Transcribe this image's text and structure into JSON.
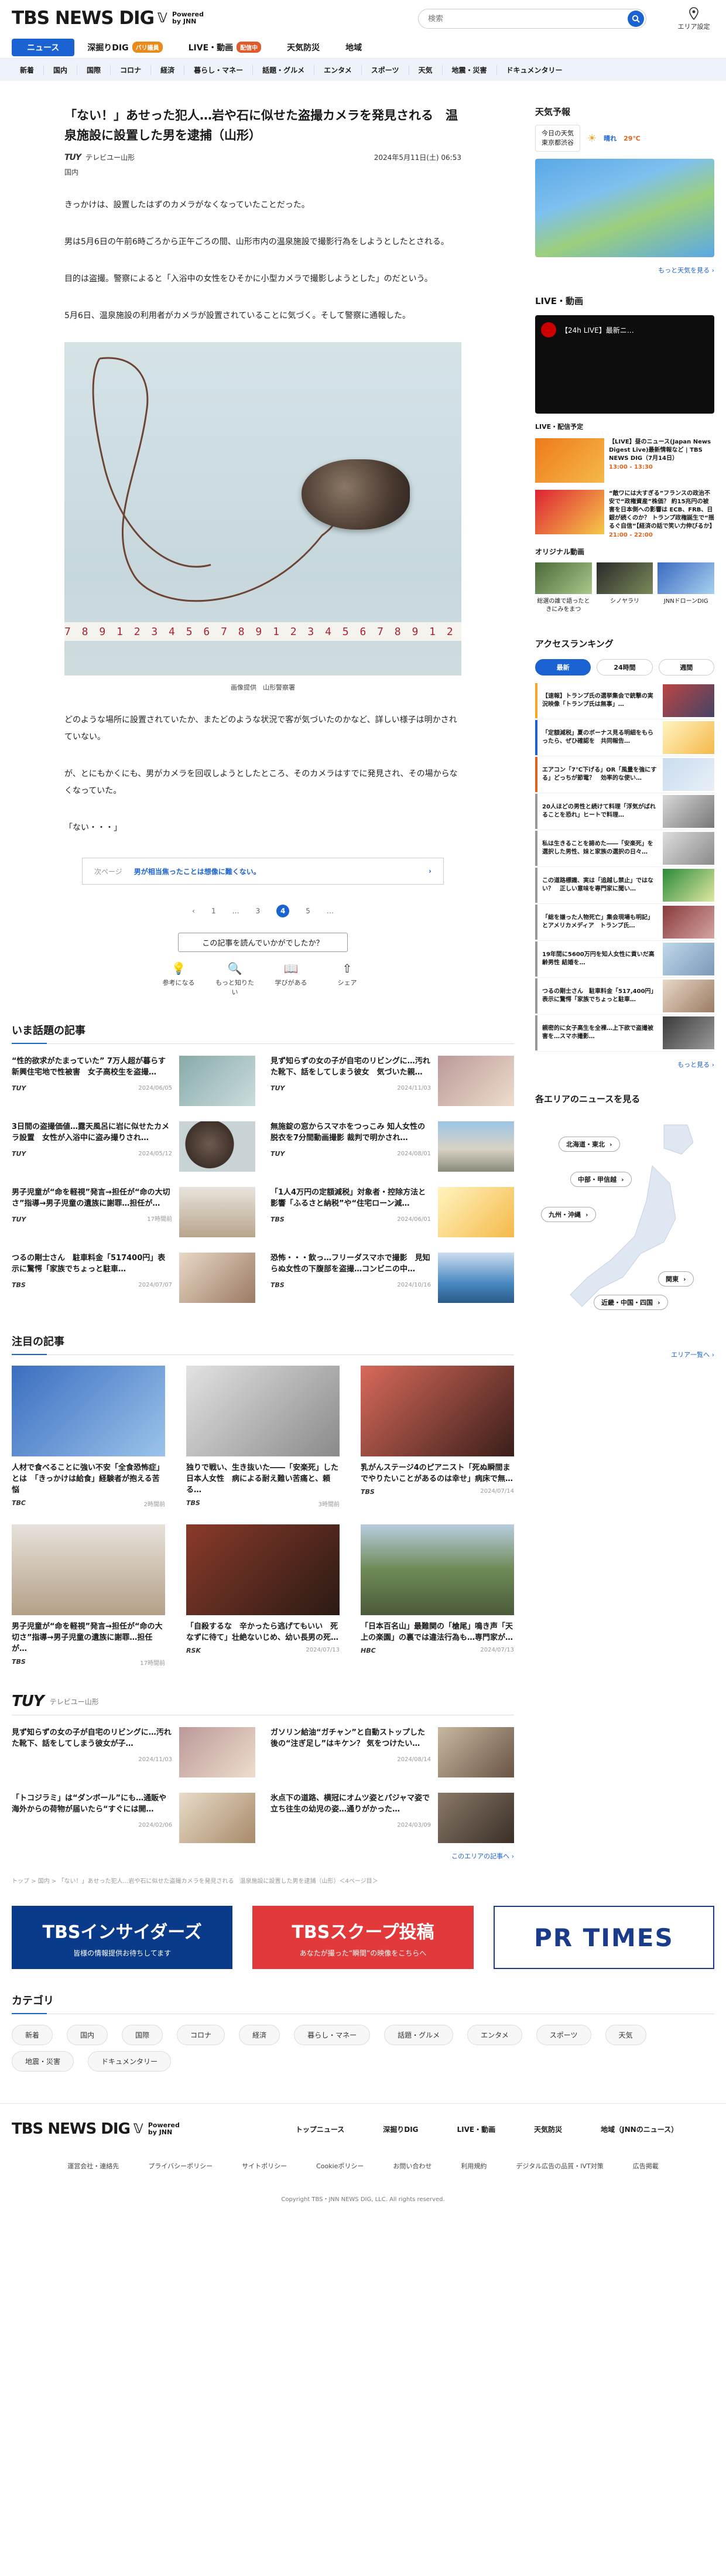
{
  "header": {
    "logo": "TBS NEWS DIG",
    "logo_powered": "Powered by JNN",
    "search_placeholder": "検索",
    "area_label": "エリア設定"
  },
  "gnav": [
    {
      "label": "ニュース"
    },
    {
      "label": "深掘りDIG",
      "badge": "バリ議員"
    },
    {
      "label": "LIVE・動画",
      "badge": "配信中"
    },
    {
      "label": "天気防災"
    },
    {
      "label": "地域"
    }
  ],
  "subnav": [
    "新着",
    "国内",
    "国際",
    "コロナ",
    "経済",
    "暮らし・マネー",
    "話題・グルメ",
    "エンタメ",
    "スポーツ",
    "天気",
    "地震・災害",
    "ドキュメンタリー"
  ],
  "article": {
    "title": "「ない！」あせった犯人…岩や石に似せた盗撮カメラを発見される　温泉施設に設置した男を逮捕（山形）",
    "source": "テレビユー山形",
    "source_logo": "TUY",
    "datetime": "2024年5月11日(土) 06:53",
    "tag": "国内",
    "paragraphs": [
      "きっかけは、設置したはずのカメラがなくなっていたことだった。",
      "男は5月6日の午前6時ごろから正午ごろの間、山形市内の温泉施設で撮影行為をしようとしたとされる。",
      "目的は盗撮。警察によると「入浴中の女性をひそかに小型カメラで撮影しようとした」のだという。",
      "5月6日、温泉施設の利用者がカメラが設置されていることに気づく。そして警察に通報した。"
    ],
    "ruler": "7 8 9 1 2 3 4 5 6 7 8 9 1 2 3 4 5 6 7 8 9 1 2 3 4 5 6 7 8 9",
    "caption": "画像提供　山形警察署",
    "paragraphs2": [
      "どのような場所に設置されていたか、またどのような状況で客が気づいたのかなど、詳しい様子は明かされていない。",
      "が、とにもかくにも、男がカメラを回収しようとしたところ、そのカメラはすでに発見され、その場からなくなっていた。",
      "「ない・・・」"
    ],
    "related_label": "次ページ",
    "related_text": "男が相当焦ったことは想像に難くない。",
    "pages": [
      "1",
      "…",
      "3",
      "4",
      "5",
      "…"
    ],
    "feedback_q": "この記事を読んでいかがでしたか？",
    "reactions": [
      {
        "icon": "💡",
        "label": "参考になる"
      },
      {
        "icon": "🔍",
        "label": "もっと知りたい"
      },
      {
        "icon": "📖",
        "label": "学びがある"
      },
      {
        "icon": "⇧",
        "label": "シェア"
      }
    ]
  },
  "trending": {
    "title": "いま話題の記事",
    "items": [
      {
        "text": "“性的欲求がたまっていた” 7万人超が暮らす新興住宅地で性被害　女子高校生を盗撮…",
        "src": "TUY",
        "date": "2024/06/05"
      },
      {
        "text": "見ず知らずの女の子が自宅のリビングに…汚れた靴下、話をしてしまう彼女　気づいた親…",
        "src": "TUY",
        "date": "2024/11/03"
      },
      {
        "text": "3日間の盗撮価値…露天風呂に岩に似せたカメラ設置　女性が入浴中に盗み撮りされ…",
        "src": "TUY",
        "date": "2024/05/12"
      },
      {
        "text": "無施錠の窓からスマホをつっこみ 知人女性の脱衣を7分間動画撮影 裁判で明かされ…",
        "src": "TUY",
        "date": "2024/08/01"
      },
      {
        "text": "男子児童が“命を軽視”発言→担任が“命の大切さ”指導→男子児童の遺族に謝罪…担任が…",
        "src": "TUY",
        "date": "17時間前"
      },
      {
        "text": "「1人4万円の定額減税」対象者・控除方法と影響「ふるさと納税”や“住宅ローン減…",
        "src": "TBS",
        "date": "2024/06/01"
      },
      {
        "text": "つるの剛士さん　駐車料金「517400円」表示に驚愕「家族でちょっと駐車…",
        "src": "TBS",
        "date": "2024/07/07"
      },
      {
        "text": "恐怖・・・飲っ…フリーダスマホで撮影　見知らぬ女性の下腹部を盗撮…コンビニの中…",
        "src": "TBS",
        "date": "2024/10/16"
      }
    ]
  },
  "featured": {
    "title": "注目の記事",
    "items": [
      {
        "text": "人材で食べることに強い不安「全食恐怖症」とは　「きっかけは給食」経験者が抱える苦悩",
        "src": "TBC",
        "date": "2時間前"
      },
      {
        "text": "独りで戦い、生き抜いた――「安楽死」した日本人女性　病による耐え難い苦痛と、頼る…",
        "src": "TBS",
        "date": "3時間前"
      },
      {
        "text": "乳がんステージ4のピアニスト「死ぬ瞬間までやりたいことがあるのは幸せ」病床で無…",
        "src": "TBS",
        "date": "2024/07/14"
      },
      {
        "text": "男子児童が“命を軽視”発言→担任が“命の大切さ”指導→男子児童の遺族に謝罪…担任が…",
        "src": "TBS",
        "date": "17時間前"
      },
      {
        "text": "「自殺するな　辛かったら逃げてもいい　死なずに待て」壮絶ないじめ、幼い長男の死…",
        "src": "RSK",
        "date": "2024/07/13"
      },
      {
        "text": "「日本百名山」最難関の「槍尾」鳴き声「天上の楽園」の裏では違法行為も…専門家が…",
        "src": "HBC",
        "date": "2024/07/13"
      }
    ]
  },
  "local": {
    "logo": "TUY",
    "name": "テレビユー山形",
    "items": [
      {
        "text": "見ず知らずの女の子が自宅のリビングに…汚れた靴下、話をしてしまう彼女が子…",
        "date": "2024/11/03"
      },
      {
        "text": "ガソリン給油“ガチャン”と自動ストップした後の“注ぎ足し”はキケン？ 気をつけたい…",
        "date": "2024/08/14"
      },
      {
        "text": "「トコジラミ」は“ダンボール”にも…通販や海外からの荷物が届いたら“すぐには開…",
        "date": "2024/02/06"
      },
      {
        "text": "氷点下の道路、横冠にオムツ姿とパジャマ姿で立ち往生の幼児の姿…通りがかった…",
        "date": "2024/03/09"
      }
    ],
    "more": "このエリアの記事へ ›"
  },
  "breadcrumb": "トップ > 国内 > 「ない！」あせった犯人…岩や石に似せた盗撮カメラを発見される　温泉施設に設置した男を逮捕（山形）＜4ページ目＞",
  "banners": [
    {
      "title": "TBSインサイダーズ",
      "sub": "皆様の情報提供お待ちしてます"
    },
    {
      "title": "TBSスクープ投稿",
      "sub": "あなたが撮った“瞬間”の映像をこちらへ"
    },
    {
      "title": "PR TIMES",
      "sub": ""
    }
  ],
  "categories": {
    "title": "カテゴリ",
    "items": [
      "新着",
      "国内",
      "国際",
      "コロナ",
      "経済",
      "暮らし・マネー",
      "話題・グルメ",
      "エンタメ",
      "スポーツ",
      "天気",
      "地震・災害",
      "ドキュメンタリー"
    ]
  },
  "footer": {
    "nav": [
      "トップニュース",
      "深掘りDIG",
      "LIVE・動画",
      "天気防災",
      "地域（JNNのニュース）"
    ],
    "links": [
      "運営会社・連絡先",
      "プライバシーポリシー",
      "サイトポリシー",
      "Cookieポリシー",
      "お問い合わせ",
      "利用規約",
      "デジタル広告の品質・IVT対策",
      "広告掲載"
    ],
    "copyright": "Copyright TBS・JNN NEWS DIG, LLC. All rights reserved."
  },
  "side": {
    "weather_title": "天気予報",
    "weather_today": "今日の天気",
    "weather_area": "東京都渋谷",
    "weather_cond": "晴れ",
    "weather_temp": "29℃",
    "weather_more": "もっと天気を見る ›",
    "live_title": "LIVE・動画",
    "live_video_label": "【24h LIVE】最新ニ…",
    "live_tag": "LIVE・配信予定",
    "live_items": [
      {
        "text": "【LIVE】昼のニュース(Japan News Digest Live)最新情報など | TBS NEWS DIG（7月14日）",
        "time": "13:00 - 13:30"
      },
      {
        "text": "“敵ワには大すぎる”フランスの政治不安で“政権資産”株価？ 約15兆円の被害を日本側への影響は ECB、FRB、日銀が続くのか？ トランプ政権誕生で“揺るぐ自信”【経済の話で笑い力伸びるか】",
        "time": "21:00 - 22:00"
      }
    ],
    "orig_title": "オリジナル動画",
    "orig": [
      "総選の誰で語ったときにみをまつ",
      "シノヤラリ",
      "JNNドローンDIG"
    ],
    "rank_title": "アクセスランキング",
    "rank_tabs": [
      "最新",
      "24時間",
      "週間"
    ],
    "ranks": [
      "【速報】トランプ氏の選挙集会で銃撃の実況映像「トランプ氏は無事」…",
      "「定額減税」夏のボーナス見る明細をもらったら、ぜひ確認を　共同報告…",
      "エアコン「7℃下げる」OR「風量を強にする」どっちが節電？　効率的な使い…",
      "20人ほどの男性と続けて料理「浮気がばれることを恐れ」ヒートで料理…",
      "私は生きることを諦めた――「安楽死」を選択した男性、妹と家族の選択の日々…",
      "この道路標識、実は「追越し禁止」ではない？　正しい意味を専門家に聞い…",
      "「総を嫌った人物死亡」集会現場も明記」とアメリカメディア　トランプ氏…",
      "19年間に5600万円を知人女性に貢いだ高齢男性 結婚を…",
      "つるの剛士さん　駐車料金「517,400円」表示に驚愕「家族でちょっと駐車…",
      "親密的に女子高生を全裸…上下欲で盗撮被害を…スマホ撮影…"
    ],
    "rank_more": "もっと見る ›",
    "area_title": "各エリアのニュースを見る",
    "regions": [
      "北海道・東北",
      "中部・甲信越",
      "九州・沖縄",
      "関東",
      "近畿・中国・四国"
    ],
    "area_more": "エリア一覧へ ›"
  }
}
